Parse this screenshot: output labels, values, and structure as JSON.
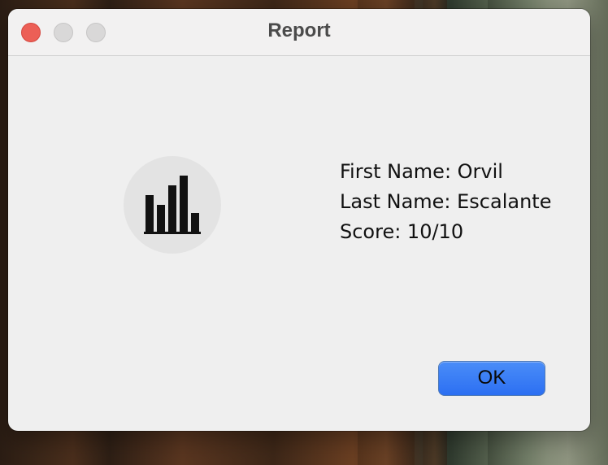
{
  "window": {
    "title": "Report"
  },
  "report": {
    "icon": "bar-chart-icon",
    "fields": [
      {
        "text": "First Name: Orvil"
      },
      {
        "text": "Last Name: Escalante"
      },
      {
        "text": "Score: 10/10"
      }
    ]
  },
  "buttons": {
    "ok_label": "OK"
  },
  "colors": {
    "accent": "#2f72f3",
    "close": "#ec5f56"
  }
}
